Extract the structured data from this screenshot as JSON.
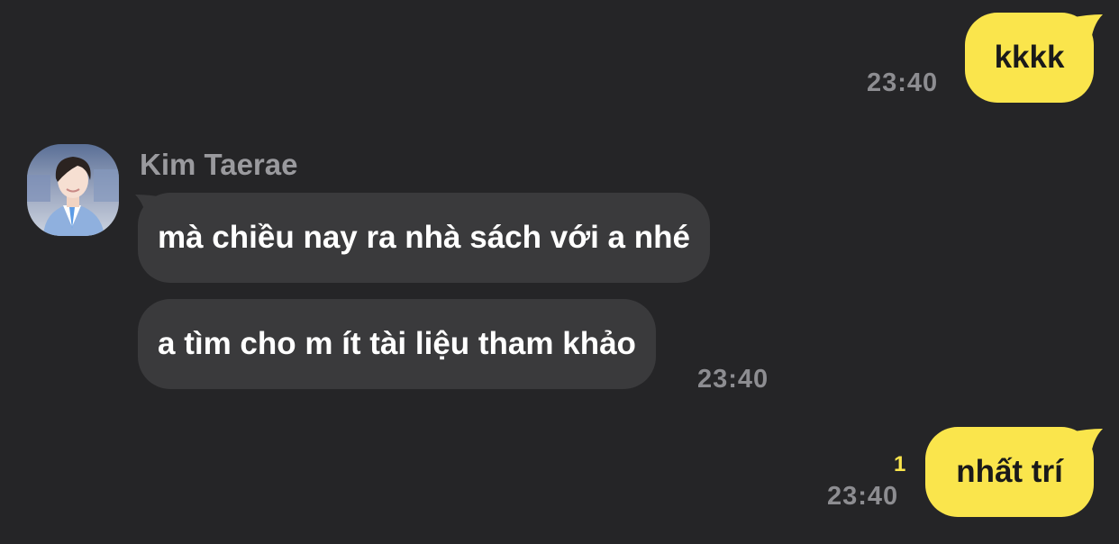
{
  "colors": {
    "background": "#252527",
    "outgoing_bubble": "#fae54c",
    "incoming_bubble": "#3a3a3c",
    "timestamp": "#8d8d91",
    "unread_count": "#fae54c"
  },
  "messages": [
    {
      "direction": "outgoing",
      "text": "kkkk",
      "time": "23:40"
    },
    {
      "direction": "incoming",
      "sender": "Kim Taerae",
      "avatar_icon": "profile-avatar",
      "texts": [
        "mà chiều nay ra nhà sách với a nhé",
        "a tìm cho m ít tài liệu tham khảo"
      ],
      "time": "23:40"
    },
    {
      "direction": "outgoing",
      "text": "nhất trí",
      "time": "23:40",
      "unread": "1"
    }
  ]
}
